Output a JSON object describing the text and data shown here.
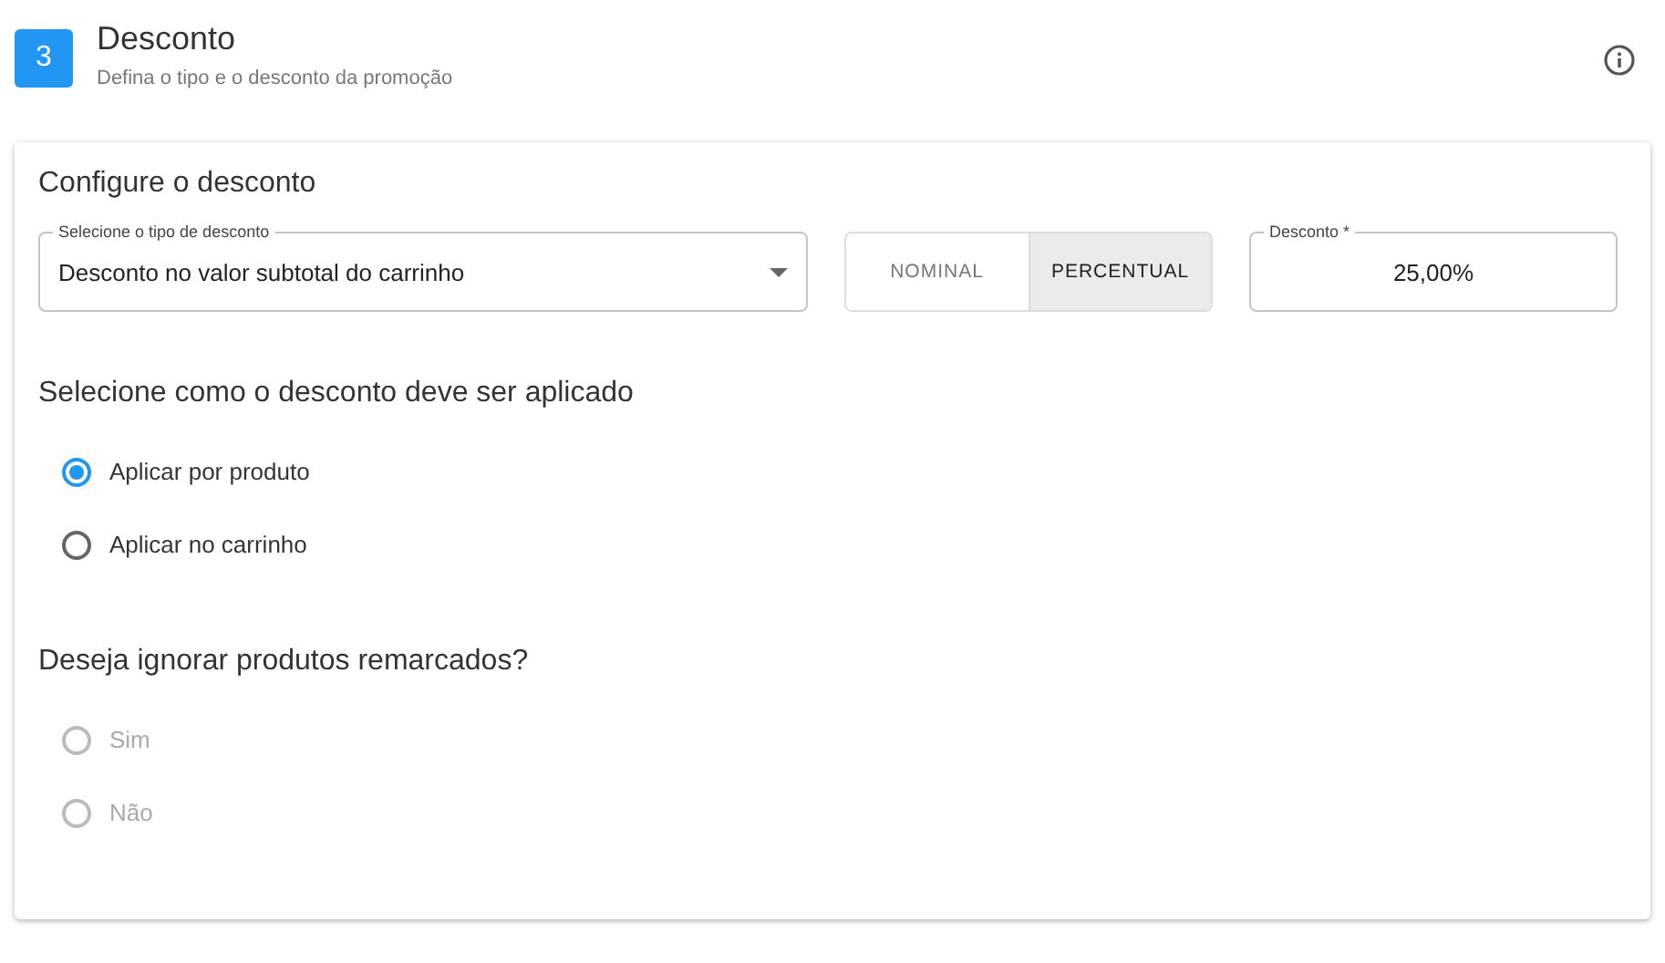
{
  "header": {
    "step": "3",
    "title": "Desconto",
    "subtitle": "Defina o tipo e o desconto da promoção"
  },
  "config": {
    "title": "Configure o desconto",
    "select": {
      "label": "Selecione o tipo de desconto",
      "value": "Desconto no valor subtotal do carrinho"
    },
    "mode": [
      {
        "label": "NOMINAL",
        "selected": false
      },
      {
        "label": "PERCENTUAL",
        "selected": true
      }
    ],
    "discount": {
      "label": "Desconto *",
      "value": "25,00%"
    }
  },
  "sections": [
    {
      "title": "Selecione como o desconto deve ser aplicado",
      "options": [
        {
          "label": "Aplicar por produto",
          "selected": true,
          "disabled": false
        },
        {
          "label": "Aplicar no carrinho",
          "selected": false,
          "disabled": false
        }
      ]
    },
    {
      "title": "Deseja ignorar produtos remarcados?",
      "options": [
        {
          "label": "Sim",
          "selected": false,
          "disabled": true
        },
        {
          "label": "Não",
          "selected": false,
          "disabled": true
        }
      ]
    }
  ]
}
